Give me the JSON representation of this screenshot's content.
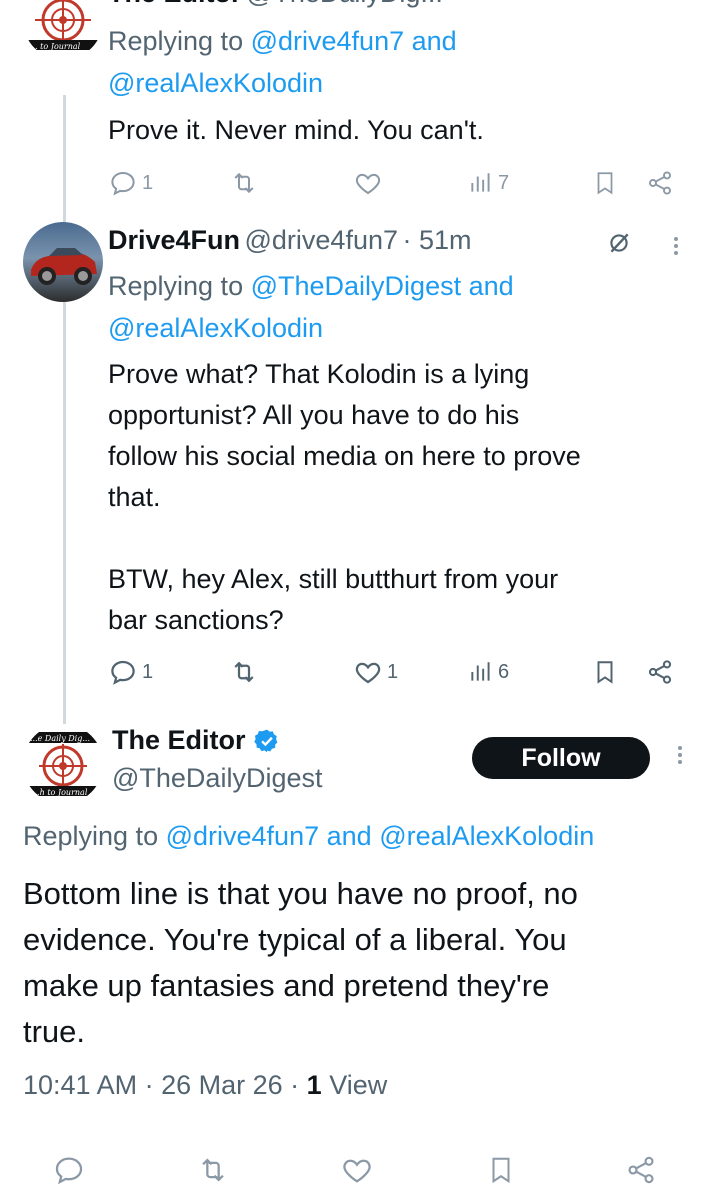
{
  "top_tweet": {
    "author_partial": "The Editor",
    "handle_partial": "@TheDailyDig...",
    "avatar_caption": "... to Journal",
    "replying_prefix": "Replying to",
    "replying_user1": "@drive4fun7",
    "replying_and": "and",
    "replying_user2": "@realAlexKolodin",
    "text": "Prove it. Never mind. You can't.",
    "replies": "1",
    "likes": "",
    "views": "7"
  },
  "middle_tweet": {
    "author": "Drive4Fun",
    "handle": "@drive4fun7",
    "time": "· 51m",
    "replying_prefix": "Replying to",
    "replying_user1": "@TheDailyDigest",
    "replying_and": "and",
    "replying_user2": "@realAlexKolodin",
    "text": "Prove what? That Kolodin is a lying\nopportunist? All you have to do his\nfollow his social media on here to prove\nthat.\n\nBTW, hey Alex, still butthurt from your\nbar sanctions?",
    "replies": "1",
    "likes": "1",
    "views": "6"
  },
  "main_tweet": {
    "author": "The Editor",
    "handle": "@TheDailyDigest",
    "avatar_caption_top": "...e Daily Dig...",
    "avatar_caption_bottom": "...h to Journal",
    "follow_label": "Follow",
    "replying_prefix": "Replying to",
    "replying_user1": "@drive4fun7",
    "replying_and": "and",
    "replying_user2": "@realAlexKolodin",
    "text": "Bottom line is that you have no proof, no\nevidence. You're typical of a liberal. You\nmake up fantasies and pretend they're\ntrue.",
    "time": "10:41 AM · 26 Mar 26 ·",
    "view_count": "1",
    "view_label": "View"
  },
  "colors": {
    "link": "#1d9bf0",
    "muted": "#536471",
    "icon": "#8b98a5",
    "verified": "#1d9bf0",
    "follow_bg": "#0f1419"
  }
}
